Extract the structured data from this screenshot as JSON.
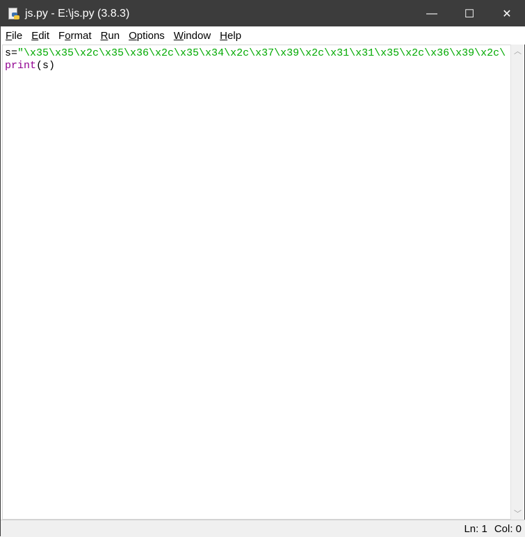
{
  "window": {
    "title": "js.py - E:\\js.py (3.8.3)",
    "minimize": "—",
    "maximize": "☐",
    "close": "✕"
  },
  "menu": [
    {
      "first": "F",
      "rest": "ile"
    },
    {
      "first": "E",
      "rest": "dit"
    },
    {
      "first": "F",
      "pre": "",
      "rest": "ormat",
      "u_index": 1,
      "label": "Format"
    },
    {
      "first": "R",
      "rest": "un"
    },
    {
      "first": "O",
      "rest": "ptions"
    },
    {
      "first": "W",
      "rest": "indow"
    },
    {
      "first": "H",
      "rest": "elp"
    }
  ],
  "code": {
    "line1_prefix": "s=",
    "line1_string": "\"\\x35\\x35\\x2c\\x35\\x36\\x2c\\x35\\x34\\x2c\\x37\\x39\\x2c\\x31\\x31\\x35\\x2c\\x36\\x39\\x2c\\",
    "line2_builtin": "print",
    "line2_rest": "(s)"
  },
  "status": {
    "line": "Ln: 1",
    "col": "Col: 0"
  },
  "colors": {
    "string": "#00aa00",
    "builtin": "#900090",
    "titlebar": "#3c3c3c"
  }
}
